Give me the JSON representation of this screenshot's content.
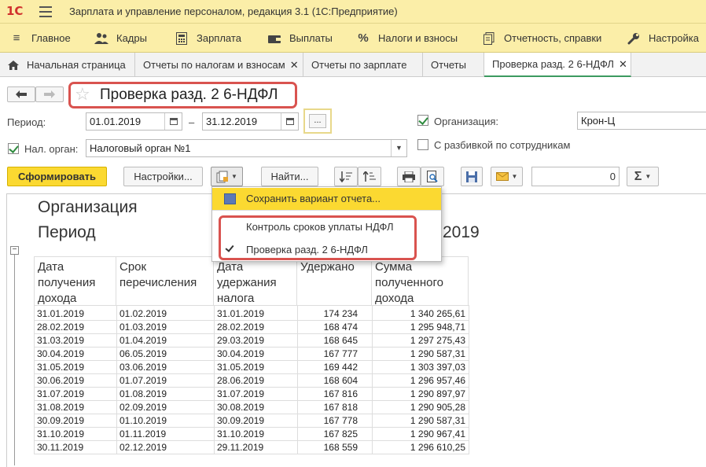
{
  "app": {
    "logo": "1С",
    "title": "Зарплата и управление персоналом, редакция 3.1  (1С:Предприятие)"
  },
  "main_menu": [
    {
      "label": "Главное",
      "icon": "hamburger-icon"
    },
    {
      "label": "Кадры",
      "icon": "people-icon"
    },
    {
      "label": "Зарплата",
      "icon": "calculator-icon"
    },
    {
      "label": "Выплаты",
      "icon": "wallet-icon"
    },
    {
      "label": "Налоги и взносы",
      "icon": "percent-icon"
    },
    {
      "label": "Отчетность, справки",
      "icon": "documents-icon"
    },
    {
      "label": "Настройка",
      "icon": "wrench-icon"
    }
  ],
  "tabs": [
    {
      "label": "Начальная страница",
      "closable": false
    },
    {
      "label": "Отчеты по налогам и взносам",
      "closable": true
    },
    {
      "label": "Отчеты по зарплате",
      "closable": true
    },
    {
      "label": "Отчеты",
      "closable": false
    },
    {
      "label": "Проверка разд. 2 6-НДФЛ",
      "closable": true,
      "active": true
    }
  ],
  "form": {
    "title": "Проверка разд. 2 6-НДФЛ",
    "period_label": "Период:",
    "period_from": "01.01.2019",
    "period_dash": "–",
    "period_to": "31.12.2019",
    "dots_label": "...",
    "org_label": "Организация:",
    "org_value": "Крон-Ц",
    "org_checked": true,
    "tax_label": "Нал. орган:",
    "tax_value": "Налоговый орган №1",
    "tax_checked": true,
    "by_employee_label": "С разбивкой по сотрудникам",
    "by_employee_checked": false
  },
  "toolbar": {
    "generate": "Сформировать",
    "settings": "Настройки...",
    "find": "Найти...",
    "sum_value": "0",
    "sigma": "Σ"
  },
  "dropdown": {
    "items": [
      {
        "label": "Сохранить вариант отчета...",
        "icon": "save-icon",
        "highlighted": true
      },
      {
        "label": "Контроль сроков уплаты НДФЛ",
        "checked": false
      },
      {
        "label": "Проверка разд. 2 6-НДФЛ",
        "checked": true
      }
    ]
  },
  "report": {
    "heading_org": "Организация",
    "heading_period": "Период",
    "heading_year_fragment": "2019",
    "columns": [
      "Дата получения дохода",
      "Срок перечисления",
      "Дата удержания налога",
      "Удержано",
      "Сумма полученного дохода"
    ],
    "rows": [
      [
        "31.01.2019",
        "01.02.2019",
        "31.01.2019",
        "174 234",
        "1 340 265,61"
      ],
      [
        "28.02.2019",
        "01.03.2019",
        "28.02.2019",
        "168 474",
        "1 295 948,71"
      ],
      [
        "31.03.2019",
        "01.04.2019",
        "29.03.2019",
        "168 645",
        "1 297 275,43"
      ],
      [
        "30.04.2019",
        "06.05.2019",
        "30.04.2019",
        "167 777",
        "1 290 587,31"
      ],
      [
        "31.05.2019",
        "03.06.2019",
        "31.05.2019",
        "169 442",
        "1 303 397,03"
      ],
      [
        "30.06.2019",
        "01.07.2019",
        "28.06.2019",
        "168 604",
        "1 296 957,46"
      ],
      [
        "31.07.2019",
        "01.08.2019",
        "31.07.2019",
        "167 816",
        "1 290 897,97"
      ],
      [
        "31.08.2019",
        "02.09.2019",
        "30.08.2019",
        "167 818",
        "1 290 905,28"
      ],
      [
        "30.09.2019",
        "01.10.2019",
        "30.09.2019",
        "167 778",
        "1 290 587,31"
      ],
      [
        "31.10.2019",
        "01.11.2019",
        "31.10.2019",
        "167 825",
        "1 290 967,41"
      ],
      [
        "30.11.2019",
        "02.12.2019",
        "29.11.2019",
        "168 559",
        "1 296 610,25"
      ]
    ]
  },
  "colors": {
    "accent_yellow": "#fbd931",
    "bar_yellow": "#fbeea8",
    "highlight_red": "#d9534f",
    "active_tab_green": "#3c9a60"
  }
}
